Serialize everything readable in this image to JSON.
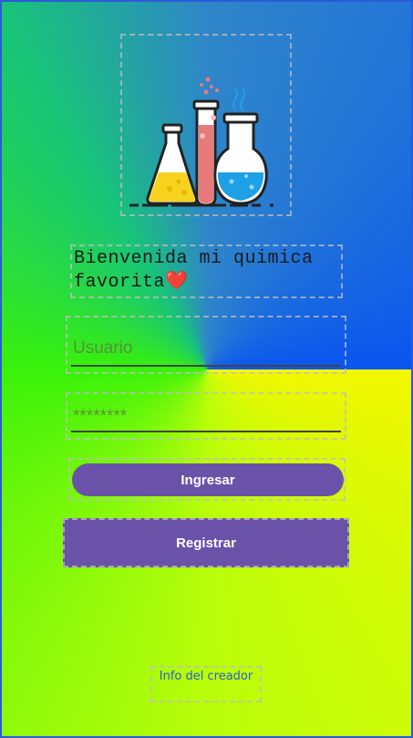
{
  "login": {
    "welcome_line1": "Bienvenida mi quimica",
    "welcome_line2": "favorita❤️",
    "username_placeholder": "Usuario",
    "password_placeholder": "********",
    "login_button_label": "Ingresar",
    "register_button_label": "Registrar",
    "creator_info_label": "Info del creador"
  },
  "logo": {
    "icon": "chemistry-flasks-icon"
  },
  "colors": {
    "button": "#6a52a8",
    "link": "#2a5fd0",
    "gradient_green": "#39f20a",
    "gradient_yellow": "#f3f700",
    "gradient_blue": "#0a55f0",
    "gradient_teal": "#2f86c9"
  }
}
